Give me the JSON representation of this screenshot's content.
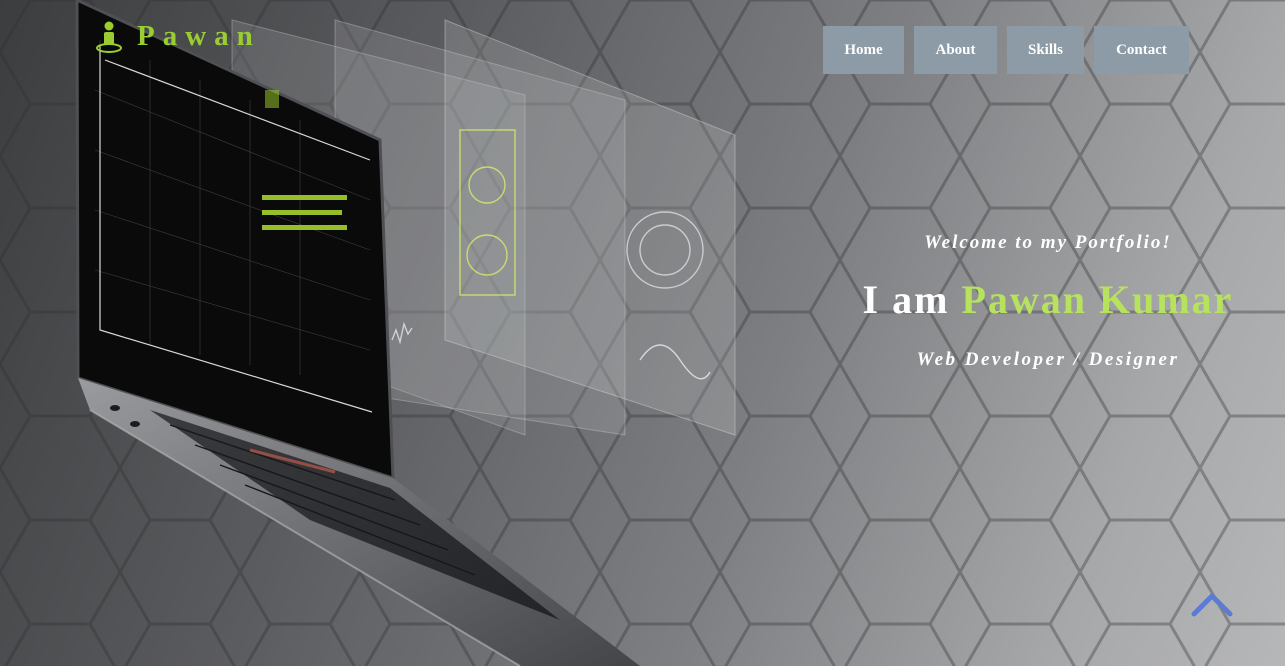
{
  "brand": {
    "name": "Pawan",
    "icon": "person-icon",
    "color": "#9acd32"
  },
  "nav": {
    "items": [
      {
        "label": "Home"
      },
      {
        "label": "About"
      },
      {
        "label": "Skills"
      },
      {
        "label": "Contact"
      }
    ],
    "button_color": "#8c9ba6"
  },
  "intro": {
    "welcome": "Welcome to my Portfolio!",
    "greeting": "I am",
    "name": "Pawan Kumar",
    "role": "Web Developer / Designer",
    "accent_color": "#b7e25e"
  },
  "scroll_top": {
    "icon": "chevron-up-icon",
    "color": "#5b7bd5"
  }
}
